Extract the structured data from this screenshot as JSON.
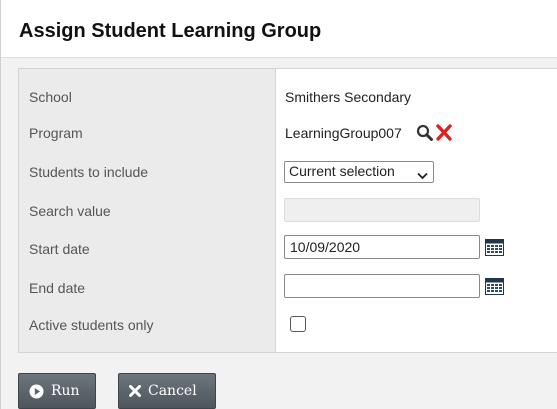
{
  "dialog": {
    "title": "Assign Student Learning Group"
  },
  "form": {
    "school": {
      "label": "School",
      "value": "Smithers Secondary"
    },
    "program": {
      "label": "Program",
      "value": "LearningGroup007"
    },
    "students_to_include": {
      "label": "Students to include",
      "selected": "Current selection"
    },
    "search_value": {
      "label": "Search value",
      "value": ""
    },
    "start_date": {
      "label": "Start date",
      "value": "10/09/2020"
    },
    "end_date": {
      "label": "End date",
      "value": ""
    },
    "active_only": {
      "label": "Active students only",
      "checked": false
    }
  },
  "buttons": {
    "run": "Run",
    "cancel": "Cancel"
  },
  "icons": {
    "search": "search-icon",
    "clear": "clear-x-icon",
    "calendar": "calendar-icon",
    "run": "play-circle-icon",
    "cancel": "x-icon"
  },
  "colors": {
    "clear_x": "#e02020",
    "button_bg": "#5d646a"
  }
}
